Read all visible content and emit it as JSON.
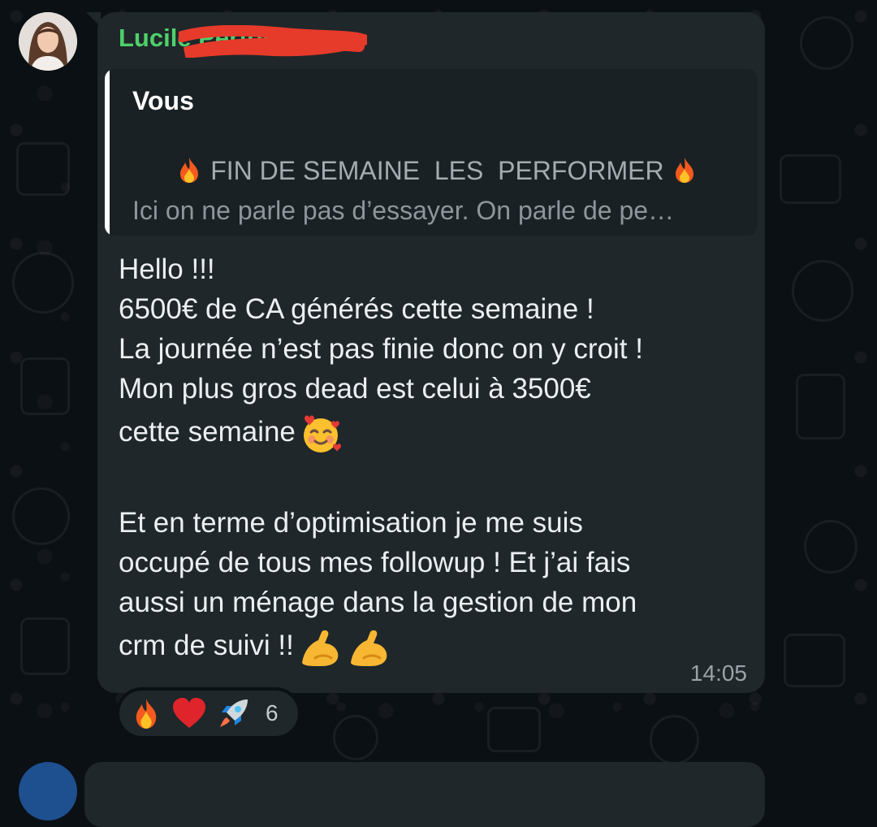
{
  "message": {
    "sender_name": "Lucile Performer",
    "quote": {
      "author": "Vous",
      "line1": " FIN DE SEMAINE  LES  PERFORMER ",
      "line2": "Ici on ne parle pas d’essayer. On parle de pe…"
    },
    "body_lines": [
      "Hello !!!",
      "6500€ de CA générés cette semaine !",
      "La journée n’est pas finie donc on y croit !",
      "Mon plus gros dead est celui à 3500€",
      "cette semaine",
      "Et en terme d’optimisation je me suis",
      "occupé de tous mes followup ! Et j’ai fais",
      "aussi un ménage dans la gestion de mon",
      "crm de suivi !!"
    ],
    "time": "14:05"
  },
  "reactions": {
    "icons": [
      "fire-icon",
      "heart-icon",
      "rocket-icon"
    ],
    "count": "6"
  },
  "colors": {
    "sender_name": "#4fd06a",
    "bubble": "#1f272a",
    "background": "#0b1014"
  }
}
